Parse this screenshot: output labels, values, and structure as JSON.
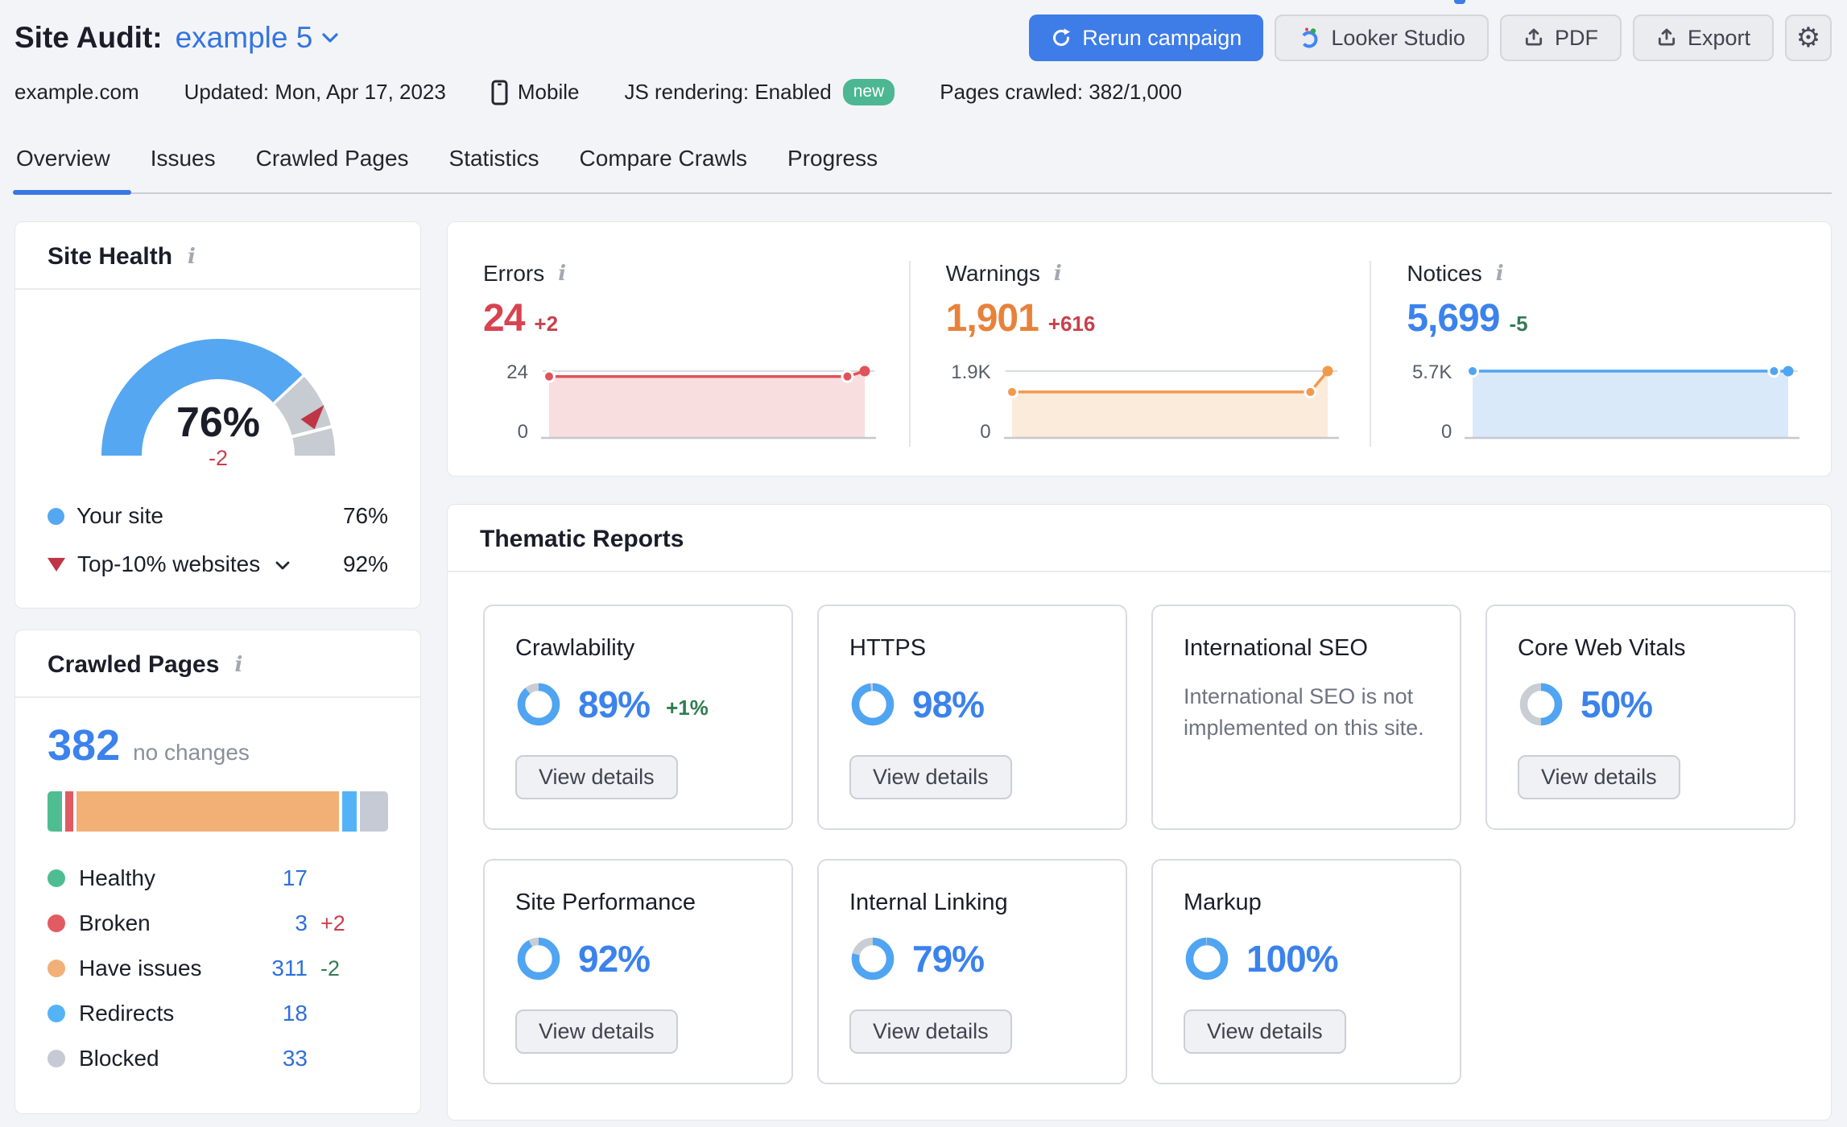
{
  "header": {
    "title": "Site Audit:",
    "project": "example 5",
    "domain": "example.com",
    "updated": "Updated: Mon, Apr 17, 2023",
    "device": "Mobile",
    "js_rendering": "JS rendering: Enabled",
    "js_badge": "new",
    "pages_crawled": "Pages crawled: 382/1,000",
    "buttons": {
      "rerun": "Rerun campaign",
      "looker": "Looker Studio",
      "pdf": "PDF",
      "export": "Export"
    }
  },
  "tabs": {
    "active": "Overview",
    "items": [
      {
        "label": "Overview"
      },
      {
        "label": "Issues"
      },
      {
        "label": "Crawled Pages"
      },
      {
        "label": "Statistics"
      },
      {
        "label": "Compare Crawls"
      },
      {
        "label": "Progress"
      }
    ]
  },
  "site_health": {
    "title": "Site Health",
    "value_pct": 76,
    "value_label": "76%",
    "delta": "-2",
    "benchmark_pct": 92,
    "legend": [
      {
        "label": "Your site",
        "value": "76%"
      },
      {
        "label": "Top-10% websites",
        "value": "92%"
      }
    ]
  },
  "counters": [
    {
      "label": "Errors",
      "value": "24",
      "delta": "+2",
      "value_color": "#D8434F",
      "delta_color": "#C8404B",
      "axis_top": "24",
      "axis_bottom": "0",
      "max": 24,
      "points": [
        [
          0,
          22
        ],
        [
          0.945,
          22
        ],
        [
          1,
          24
        ]
      ],
      "line": "#E0525A",
      "fill": "#F9DEDF"
    },
    {
      "label": "Warnings",
      "value": "1,901",
      "delta": "+616",
      "value_color": "#E8823B",
      "delta_color": "#C8404B",
      "axis_top": "1.9K",
      "axis_bottom": "0",
      "max": 1901,
      "points": [
        [
          0,
          1285
        ],
        [
          0.945,
          1285
        ],
        [
          1,
          1901
        ]
      ],
      "line": "#F19A4D",
      "fill": "#FBEBDA"
    },
    {
      "label": "Notices",
      "value": "5,699",
      "delta": "-5",
      "value_color": "#3B82EC",
      "delta_color": "#357B53",
      "axis_top": "5.7K",
      "axis_bottom": "0",
      "max": 5704,
      "points": [
        [
          0,
          5704
        ],
        [
          0.955,
          5701
        ],
        [
          1,
          5699
        ]
      ],
      "line": "#4FA5F2",
      "fill": "#D9E9FA"
    }
  ],
  "thematic": {
    "title": "Thematic Reports",
    "view_details": "View details",
    "cards": [
      {
        "name": "Crawlability",
        "percent": 89,
        "percent_label": "89%",
        "delta": "+1%"
      },
      {
        "name": "HTTPS",
        "percent": 98,
        "percent_label": "98%"
      },
      {
        "name": "International SEO",
        "note": "International SEO is not implemented on this site."
      },
      {
        "name": "Core Web Vitals",
        "percent": 50,
        "percent_label": "50%"
      },
      {
        "name": "Site Performance",
        "percent": 92,
        "percent_label": "92%"
      },
      {
        "name": "Internal Linking",
        "percent": 79,
        "percent_label": "79%"
      },
      {
        "name": "Markup",
        "percent": 100,
        "percent_label": "100%"
      }
    ]
  },
  "crawled_pages": {
    "title": "Crawled Pages",
    "total": "382",
    "change": "no changes",
    "legend": [
      {
        "label": "Healthy",
        "value": "17",
        "count": 17,
        "color": "#4FBD92"
      },
      {
        "label": "Broken",
        "value": "3",
        "count": 3,
        "color": "#E25A62",
        "delta": "+2",
        "delta_color": "#C8404B"
      },
      {
        "label": "Have issues",
        "value": "311",
        "count": 311,
        "color": "#F2B077",
        "delta": "-2",
        "delta_color": "#357B53"
      },
      {
        "label": "Redirects",
        "value": "18",
        "count": 18,
        "color": "#54B3F7"
      },
      {
        "label": "Blocked",
        "value": "33",
        "count": 33,
        "color": "#C6CAD4"
      }
    ]
  },
  "colors": {
    "accent_blue": "#3B82EC",
    "link_blue": "#2F6FDB",
    "sky_blue": "#55A7F2",
    "gauge_gray": "#C7CBD2",
    "donut_gray": "#C9CDD4",
    "donut_blue": "#4FA5F2",
    "marker_red": "#BE3645",
    "delta_red": "#C8404B",
    "delta_green": "#357B53",
    "badge_green": "#4CB792"
  }
}
